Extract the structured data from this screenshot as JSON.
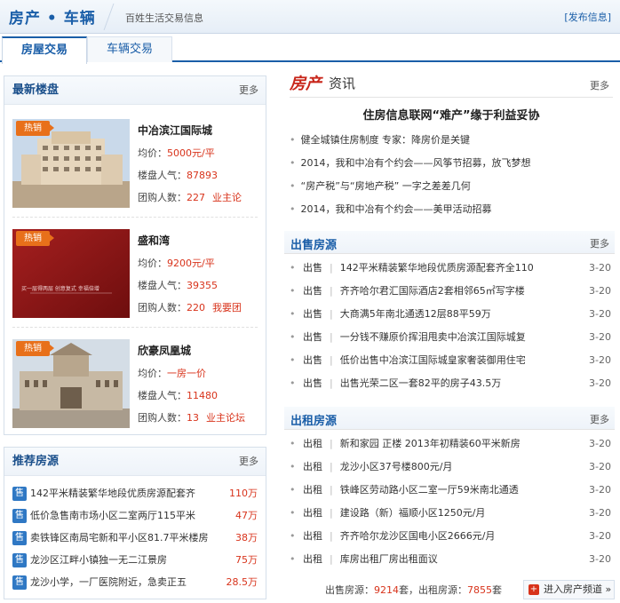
{
  "header": {
    "logo": "房产 • 车辆",
    "slogan": "百姓生活交易信息",
    "publish": "[发布信息]"
  },
  "tabs": [
    {
      "label": "房屋交易",
      "active": true
    },
    {
      "label": "车辆交易",
      "active": false
    }
  ],
  "latest": {
    "title": "最新楼盘",
    "more": "更多",
    "badge": "热销",
    "price_label": "均价：",
    "popularity_label": "楼盘人气：",
    "group_label": "团购人数：",
    "items": [
      {
        "name": "中冶滨江国际城",
        "price": "5000元/平",
        "popularity": "87893",
        "group": "227",
        "link": "业主论"
      },
      {
        "name": "盛和湾",
        "price": "9200元/平",
        "popularity": "39355",
        "group": "220",
        "link": "我要团"
      },
      {
        "name": "欣豪凤凰城",
        "price": "一房一价",
        "popularity": "11480",
        "group": "13",
        "link": "业主论坛"
      }
    ],
    "ad_text": "买一层得两层 创意复式 幸福倍增"
  },
  "recommend": {
    "title": "推荐房源",
    "more": "更多",
    "tag": "售",
    "items": [
      {
        "text": "142平米精装繁华地段优质房源配套齐",
        "price": "110万"
      },
      {
        "text": "低价急售南市场小区二室两厅115平米",
        "price": "47万"
      },
      {
        "text": "卖铁锋区南局宅新和平小区81.7平米楼房",
        "price": "38万"
      },
      {
        "text": "龙沙区江畔小镇独一无二江景房",
        "price": "75万"
      },
      {
        "text": "龙沙小学，一厂医院附近，急卖正五",
        "price": "28.5万"
      }
    ]
  },
  "news": {
    "title_a": "房产",
    "title_b": "资讯",
    "more": "更多",
    "headline": "住房信息联网“难产”缘于利益妥协",
    "items": [
      "健全城镇住房制度 专家：降房价是关键",
      "2014，我和中冶有个约会——风筝节招募，放飞梦想",
      "“房产税”与“房地产税” 一字之差差几何",
      "2014，我和中冶有个约会——美甲活动招募"
    ]
  },
  "sale": {
    "title": "出售房源",
    "more": "更多",
    "type": "出售",
    "items": [
      {
        "text": "142平米精装繁华地段优质房源配套齐全110",
        "date": "3-20"
      },
      {
        "text": "齐齐哈尔君汇国际酒店2套相邻65㎡写字楼",
        "date": "3-20"
      },
      {
        "text": "大商满5年南北通透12层88平59万",
        "date": "3-20"
      },
      {
        "text": "一分钱不赚原价挥泪甩卖中冶滨江国际城复",
        "date": "3-20"
      },
      {
        "text": "低价出售中冶滨江国际城皇家奢装御用住宅",
        "date": "3-20"
      },
      {
        "text": "出售光荣二区一套82平的房子43.5万",
        "date": "3-20"
      }
    ]
  },
  "rent": {
    "title": "出租房源",
    "more": "更多",
    "type": "出租",
    "items": [
      {
        "text": "新和家园 正楼 2013年初精装60平米新房",
        "date": "3-20"
      },
      {
        "text": "龙沙小区37号楼800元/月",
        "date": "3-20"
      },
      {
        "text": "铁峰区劳动路小区二室一厅59米南北通透",
        "date": "3-20"
      },
      {
        "text": "建设路（新）福顺小区1250元/月",
        "date": "3-20"
      },
      {
        "text": "齐齐哈尔龙沙区国电小区2666元/月",
        "date": "3-20"
      },
      {
        "text": "库房出租厂房出租面议",
        "date": "3-20"
      }
    ]
  },
  "footer": {
    "sale_label": "出售房源：",
    "sale_count": "9214",
    "sale_unit": "套，",
    "rent_label": "出租房源：",
    "rent_count": "7855",
    "rent_unit": "套",
    "enter": "进入房产频道 »"
  },
  "colors": {
    "brand_blue": "#1a5ea8",
    "accent_red": "#d8331b",
    "badge_orange": "#e8701a"
  }
}
